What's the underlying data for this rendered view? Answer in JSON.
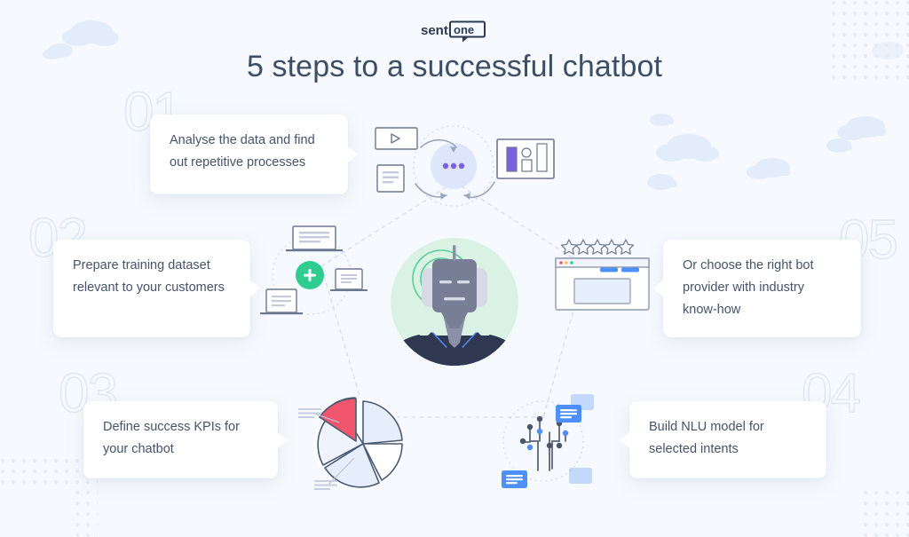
{
  "brand": {
    "name": "sentione",
    "part_one": "senti",
    "part_two": "one"
  },
  "header": {
    "title": "5 steps to a successful chatbot"
  },
  "steps": [
    {
      "number": "01",
      "text": "Analyse the data and find out repetitive processes",
      "icons": [
        "video-play-icon",
        "document-icon",
        "processing-dots-icon",
        "bar-chart-panel-icon"
      ]
    },
    {
      "number": "02",
      "text": "Prepare training dataset relevant to your customers",
      "icons": [
        "add-plus-icon",
        "dataset-card-icon"
      ]
    },
    {
      "number": "03",
      "text": "Define success KPIs for your chatbot",
      "icons": [
        "pie-chart-icon"
      ]
    },
    {
      "number": "04",
      "text": "Build NLU model for selected intents",
      "icons": [
        "neural-network-icon",
        "message-card-icon"
      ]
    },
    {
      "number": "05",
      "text": "Or choose the right bot provider with industry know-how",
      "icons": [
        "star-rating-icon",
        "browser-window-icon"
      ]
    }
  ],
  "center": {
    "label": "robot-avatar",
    "signal": "signal-waves-icon"
  },
  "colors": {
    "background": "#f6f9fd",
    "title": "#3d4f66",
    "card_text": "#45546b",
    "accent_green": "#2ecc8f",
    "accent_blue": "#4d90fb",
    "accent_purple": "#7b61e0",
    "accent_pink": "#f2566e",
    "number_outline": "#dfe7f3",
    "cloud": "#e2ecfb",
    "dots": "#e8eef8",
    "line": "#c9d3e3"
  },
  "rating": {
    "stars": 5,
    "glyph": "☆"
  }
}
